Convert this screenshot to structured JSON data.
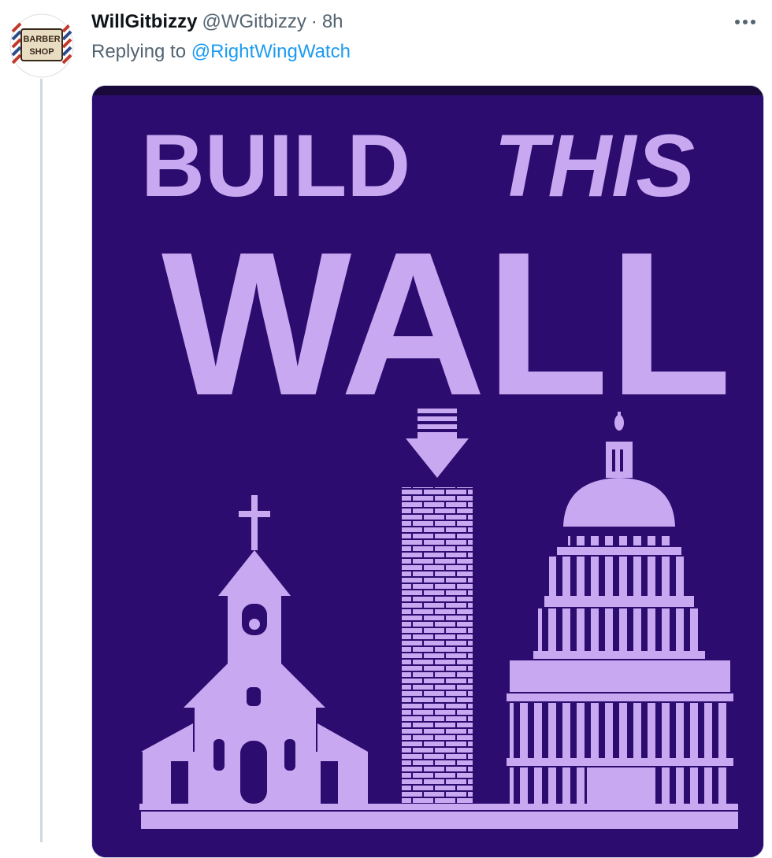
{
  "tweet": {
    "display_name": "WillGitbizzy",
    "handle": "@WGitbizzy",
    "separator": "·",
    "time": "8h",
    "reply_prefix": "Replying to",
    "reply_to": "@RightWingWatch",
    "more_icon": "more-horizontal-icon",
    "avatar": {
      "icon": "barber-shop-logo",
      "line1": "BARBER",
      "line2": "SHOP"
    }
  },
  "media": {
    "headline_line1_a": "BUILD",
    "headline_line1_b": "THIS",
    "headline_line2": "WALL",
    "icons": [
      "church-illustration",
      "arrow-down-icon",
      "brick-wall-illustration",
      "capitol-building-illustration"
    ],
    "colors": {
      "background": "#2c0c6e",
      "foreground": "#c9a8f2"
    }
  }
}
